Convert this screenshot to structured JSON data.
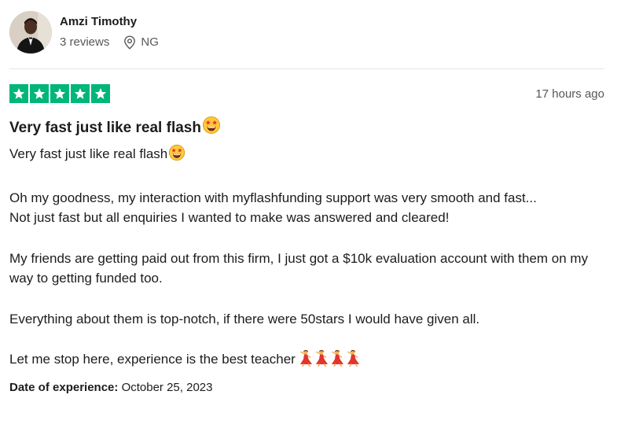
{
  "consumer": {
    "name": "Amzi Timothy",
    "reviews": "3 reviews",
    "country": "NG",
    "avatar_icon": "profile-photo-icon",
    "location_icon": "map-pin-icon"
  },
  "review": {
    "stars": 5,
    "star_color": "#00b67a",
    "date": "17 hours ago",
    "title": "Very fast just like real flash",
    "title_emoji_icon": "star-struck-emoji-icon",
    "paragraphs": {
      "p1": "Very fast just like real flash",
      "p2": "Oh my goodness, my interaction with myflashfunding support was very smooth and fast...",
      "p3": "Not just fast but all enquiries I wanted to make was answered and cleared!",
      "p4": "My friends are getting paid out from this firm, I just got a $10k evaluation account with them on my way to getting funded too.",
      "p5": "Everything about them is top-notch, if there were 50stars I would have given all.",
      "p6": "Let me stop here, experience is the best teacher"
    },
    "closing_emoji_icon": "woman-dancing-emoji-icon"
  },
  "experience": {
    "label": "Date of experience:",
    "date": "October 25, 2023"
  }
}
